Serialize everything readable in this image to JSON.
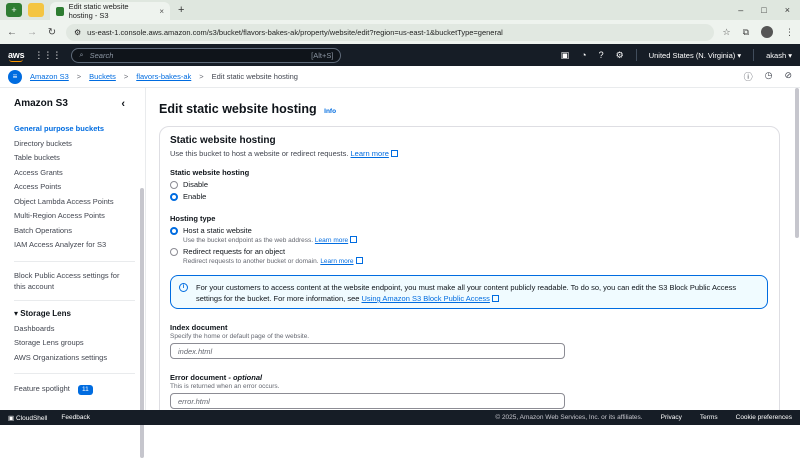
{
  "browser": {
    "tab_title": "Edit static website hosting - S3",
    "tab_close": "×",
    "new_tab": "+",
    "address": "us-east-1.console.aws.amazon.com/s3/bucket/flavors-bakes-ak/property/website/edit?region=us-east-1&bucketType=general",
    "window_controls": [
      "–",
      "□",
      "×"
    ]
  },
  "aws_header": {
    "logo": "aws",
    "search_placeholder": "Search",
    "search_hint": "[Alt+S]",
    "region": "United States (N. Virginia) ▾",
    "user": "akash ▾"
  },
  "breadcrumb": {
    "items": [
      "Amazon S3",
      "Buckets",
      "flavors-bakes-ak"
    ],
    "current": "Edit static website hosting",
    "separator": ">"
  },
  "sidebar": {
    "title": "Amazon S3",
    "collapse": "‹",
    "items": [
      "General purpose buckets",
      "Directory buckets",
      "Table buckets",
      "Access Grants",
      "Access Points",
      "Object Lambda Access Points",
      "Multi-Region Access Points",
      "Batch Operations",
      "IAM Access Analyzer for S3"
    ],
    "block_public_1": "Block Public Access settings for",
    "block_public_2": "this account",
    "storage_lens": "Storage Lens",
    "storage_items": [
      "Dashboards",
      "Storage Lens groups",
      "AWS Organizations settings"
    ],
    "feature_spotlight": "Feature spotlight",
    "spotlight_count": "11"
  },
  "main": {
    "title": "Edit static website hosting",
    "info": "Info",
    "panel_title": "Static website hosting",
    "panel_desc": "Use this bucket to host a website or redirect requests.",
    "learn_more": "Learn more",
    "hosting_label": "Static website hosting",
    "disable": "Disable",
    "enable": "Enable",
    "hosting_type_label": "Hosting type",
    "host_static": "Host a static website",
    "host_static_desc": "Use the bucket endpoint as the web address.",
    "redirect": "Redirect requests for an object",
    "redirect_desc": "Redirect requests to another bucket or domain.",
    "alert_text_1": "For your customers to access content at the website endpoint, you must make all your content publicly readable. To do so, you can edit the S3 Block Public Access",
    "alert_text_2": "settings for the bucket. For more information, see",
    "alert_link": "Using Amazon S3 Block Public Access",
    "index_label": "Index document",
    "index_desc": "Specify the home or default page of the website.",
    "index_placeholder": "index.html",
    "error_label": "Error document",
    "error_optional": "- optional",
    "error_desc": "This is returned when an error occurs.",
    "error_placeholder": "error.html"
  },
  "footer": {
    "cloudshell": "CloudShell",
    "feedback": "Feedback",
    "copyright": "© 2025, Amazon Web Services, Inc. or its affiliates.",
    "privacy": "Privacy",
    "terms": "Terms",
    "cookies": "Cookie preferences"
  }
}
